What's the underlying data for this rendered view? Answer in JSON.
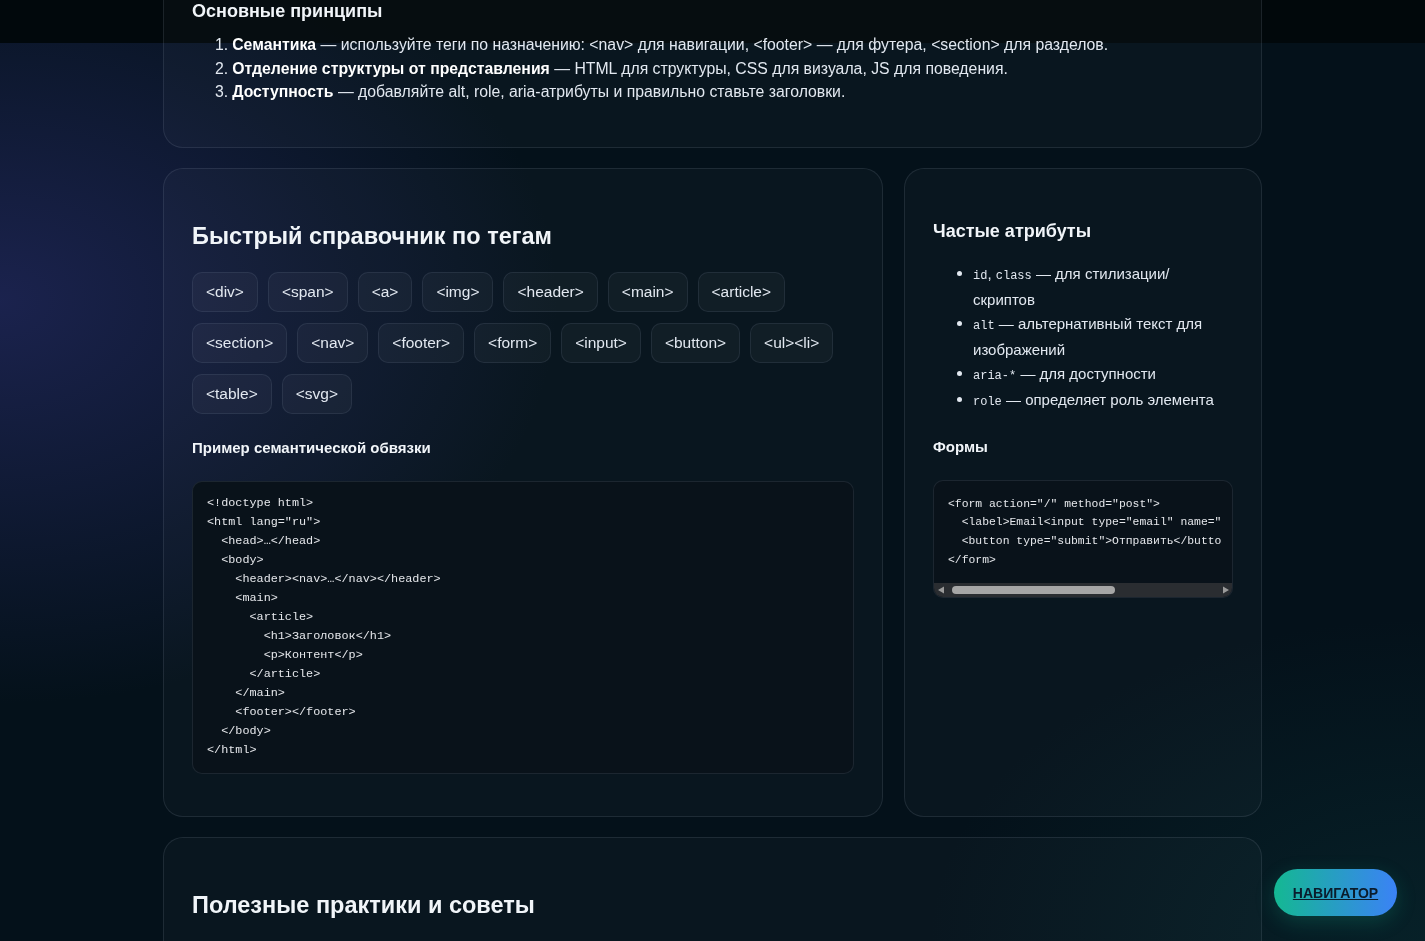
{
  "principles": {
    "title": "Основные принципы",
    "items": [
      {
        "number": "1.",
        "text": "**Семантика** — используйте теги по назначению: <nav> для навигации, <footer> — для футера, <section> для разделов."
      },
      {
        "number": "2.",
        "text": "**Отделение структуры от представления** — HTML для структуры, CSS для визуала, JS для поведения."
      },
      {
        "number": "3.",
        "text": "**Доступность** — добавляйте alt, role, aria-атрибуты и правильно ставьте заголовки."
      }
    ]
  },
  "tag_reference": {
    "title": "Быстрый справочник по тегам",
    "tags": [
      "<div>",
      "<span>",
      "<a>",
      "<img>",
      "<header>",
      "<main>",
      "<article>",
      "<section>",
      "<nav>",
      "<footer>",
      "<form>",
      "<input>",
      "<button>",
      "<ul><li>",
      "<table>",
      "<svg>"
    ],
    "example": {
      "title": "Пример семантической обвязки",
      "code": [
        "<!doctype html>",
        "<html lang=\"ru\">",
        "  <head>…</head>",
        "  <body>",
        "    <header><nav>…</nav></header>",
        "    <main>",
        "      <article>",
        "        <h1>Заголовок</h1>",
        "        <p>Контент</p>",
        "      </article>",
        "    </main>",
        "    <footer></footer>",
        "  </body>",
        "</html>"
      ]
    }
  },
  "attributes": {
    "title": "Частые атрибуты",
    "items": [
      {
        "parts": [
          {
            "kind": "code",
            "text": "id"
          },
          {
            "kind": "plain",
            "text": ", "
          },
          {
            "kind": "code",
            "text": "class"
          },
          {
            "kind": "plain",
            "text": " — для стилизации/скриптов"
          }
        ]
      },
      {
        "parts": [
          {
            "kind": "code",
            "text": "alt"
          },
          {
            "kind": "plain",
            "text": " — альтернативный текст для изображений"
          }
        ]
      },
      {
        "parts": [
          {
            "kind": "code",
            "text": "aria-*"
          },
          {
            "kind": "plain",
            "text": " — для доступности"
          }
        ]
      },
      {
        "parts": [
          {
            "kind": "code",
            "text": "role"
          },
          {
            "kind": "plain",
            "text": " — определяет роль элемента"
          }
        ]
      }
    ],
    "forms": {
      "title": "Формы",
      "code": [
        "<form action=\"/\" method=\"post\">",
        "  <label>Email<input type=\"email\" name=\"",
        "  <button type=\"submit\">Отправить</butto",
        "</form>"
      ]
    }
  },
  "practices": {
    "title": "Полезные практики и советы"
  },
  "navigator_button": {
    "label": "НАВИГАТОР"
  }
}
